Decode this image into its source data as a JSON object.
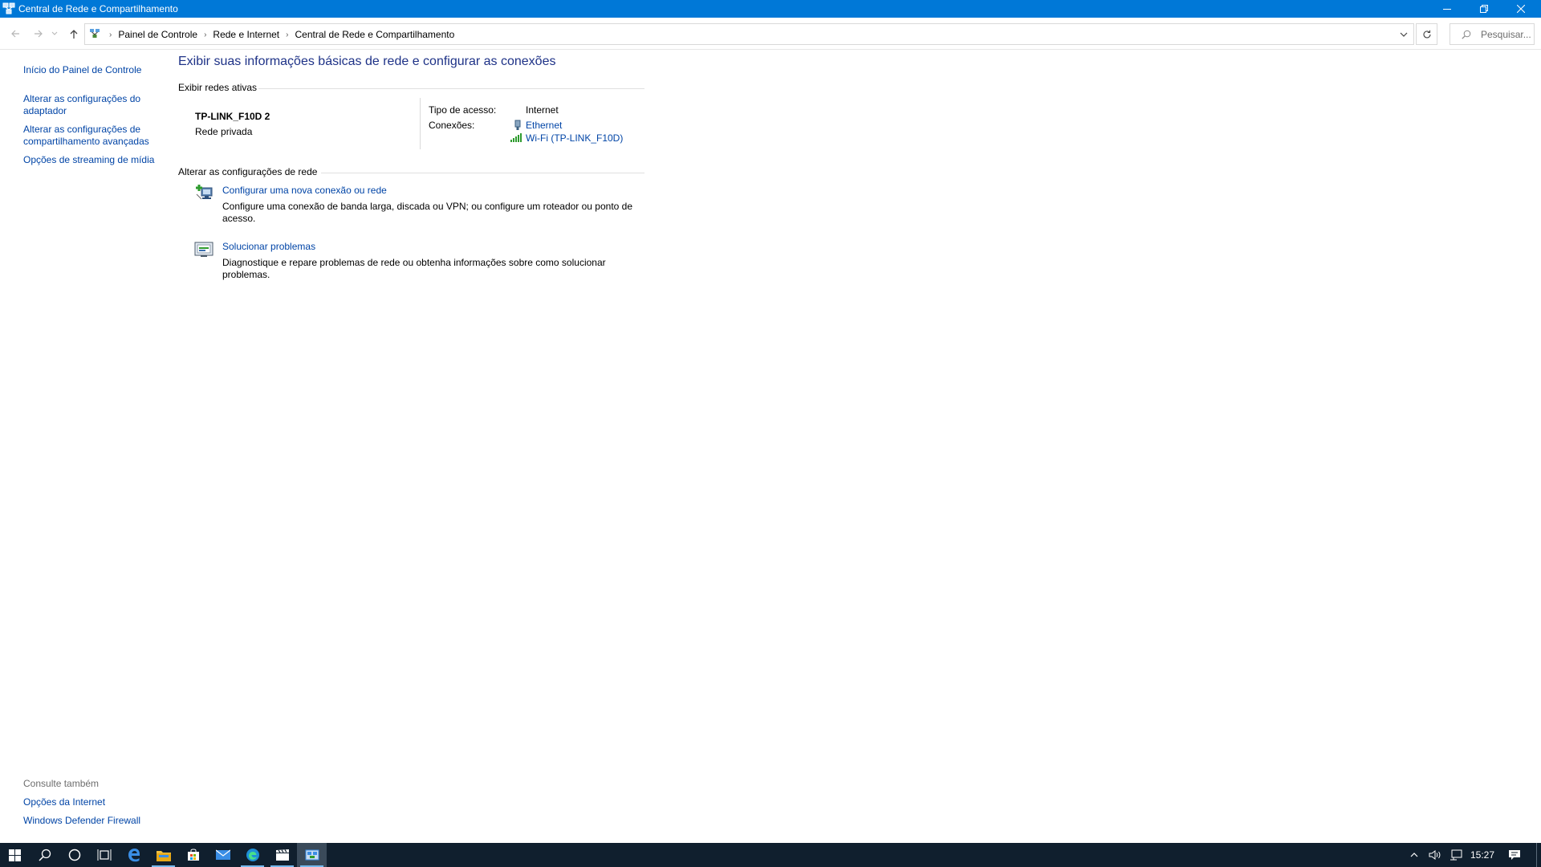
{
  "window": {
    "title": "Central de Rede e Compartilhamento"
  },
  "address": {
    "crumbs": [
      "Painel de Controle",
      "Rede e Internet",
      "Central de Rede e Compartilhamento"
    ],
    "search_placeholder": "Pesquisar..."
  },
  "sidebar": {
    "home": "Início do Painel de Controle",
    "links": [
      "Alterar as configurações do adaptador",
      "Alterar as configurações de compartilhamento avançadas",
      "Opções de streaming de mídia"
    ],
    "see_also_label": "Consulte também",
    "see_also": [
      "Opções da Internet",
      "Windows Defender Firewall"
    ]
  },
  "main": {
    "heading": "Exibir suas informações básicas de rede e configurar as conexões",
    "active_networks_label": "Exibir redes ativas",
    "network": {
      "name": "TP-LINK_F10D 2",
      "category": "Rede privada",
      "access_type_label": "Tipo de acesso:",
      "access_type_value": "Internet",
      "connections_label": "Conexões:",
      "connections": [
        "Ethernet",
        "Wi-Fi (TP-LINK_F10D)"
      ]
    },
    "change_settings_label": "Alterar as configurações de rede",
    "tasks": [
      {
        "title": "Configurar uma nova conexão ou rede",
        "description": "Configure uma conexão de banda larga, discada ou VPN; ou configure um roteador ou ponto de acesso."
      },
      {
        "title": "Solucionar problemas",
        "description": "Diagnostique e repare problemas de rede ou obtenha informações sobre como solucionar problemas."
      }
    ]
  },
  "taskbar": {
    "clock": "15:27"
  },
  "colors": {
    "titlebar": "#0078d7",
    "link": "#0044a6",
    "heading": "#1e3287",
    "taskbar": "#101f2e"
  }
}
